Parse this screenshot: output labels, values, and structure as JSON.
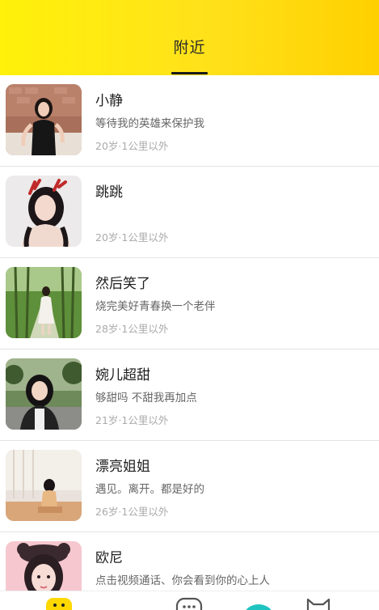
{
  "header": {
    "title": "附近"
  },
  "users": [
    {
      "name": "小静",
      "signature": "等待我的英雄来保护我",
      "meta": "20岁·1公里以外"
    },
    {
      "name": "跳跳",
      "signature": "",
      "meta": "20岁·1公里以外"
    },
    {
      "name": "然后笑了",
      "signature": "烧完美好青春换一个老伴",
      "meta": "28岁·1公里以外"
    },
    {
      "name": "婉儿超甜",
      "signature": "够甜吗 不甜我再加点",
      "meta": "21岁·1公里以外"
    },
    {
      "name": "漂亮姐姐",
      "signature": "遇见。离开。都是好的",
      "meta": "26岁·1公里以外"
    },
    {
      "name": "欧尼",
      "signature": "点击视频通话、你会看到你的心上人",
      "meta": ""
    }
  ],
  "tabbar": {
    "icons": [
      "smiley-icon",
      "chat-bubble-icon",
      "video-call-icon",
      "cat-icon"
    ],
    "colors": {
      "active": "#ffd800",
      "accent": "#1fc4c0"
    }
  }
}
